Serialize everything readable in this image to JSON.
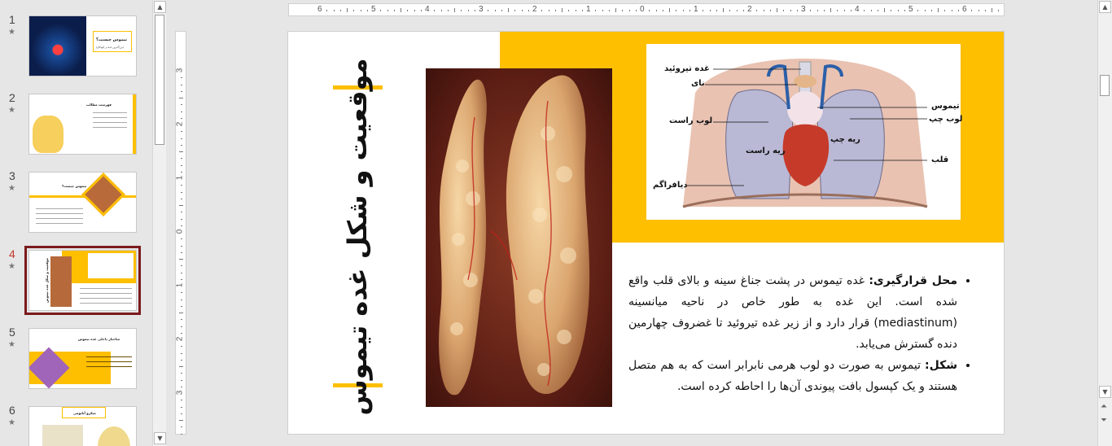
{
  "thumbnails": [
    {
      "number": "1",
      "title": "تیموس چیست؟",
      "subtitle": "(بزرگ‌ترین غده در کودکان)"
    },
    {
      "number": "2",
      "title": "فهرست مطالب"
    },
    {
      "number": "3",
      "title": "تیموس چیست؟"
    },
    {
      "number": "4",
      "title": "موقعیت و شکل غده تیموس"
    },
    {
      "number": "5",
      "title": "ساختار داخلی غده تیموس"
    },
    {
      "number": "6",
      "title": "میکرو آناتومی"
    }
  ],
  "star_glyph": "★",
  "ruler_horizontal": [
    "6",
    "5",
    "4",
    "3",
    "2",
    "1",
    "0",
    "1",
    "2",
    "3",
    "4",
    "5",
    "6"
  ],
  "ruler_vertical": [
    "3",
    "2",
    "1",
    "0",
    "1",
    "2",
    "3"
  ],
  "slide": {
    "title": "موقعیت و شکل غده تیموس",
    "anatomy_labels": {
      "thyroid": "غده تیروئید",
      "trachea": "نای",
      "right_lobe": "لوب راست",
      "diaphragm": "دیافراگم",
      "thymus": "تیموس",
      "left_lobe": "لوب چپ",
      "heart": "قلب",
      "right_lung": "ریه راست",
      "left_lung": "ریه چپ"
    },
    "bullets": [
      {
        "label": "محل قرارگیری:",
        "text": " غده تیموس در پشت جناغ سینه و بالای قلب واقع شده است. این غده به طور خاص در ناحیه میانسینه (mediastinum) قرار دارد و از زیر غده تیروئید تا غضروف چهارمین دنده گسترش می‌یابد."
      },
      {
        "label": "شکل:",
        "text": " تیموس به صورت دو لوب هرمی نابرابر است که به هم متصل هستند و یک کپسول بافت پیوندی آن‌ها را احاطه کرده است."
      }
    ]
  },
  "colors": {
    "accent": "#fdbf00",
    "selection": "#7b1a1d",
    "active_number": "#c0392b"
  }
}
